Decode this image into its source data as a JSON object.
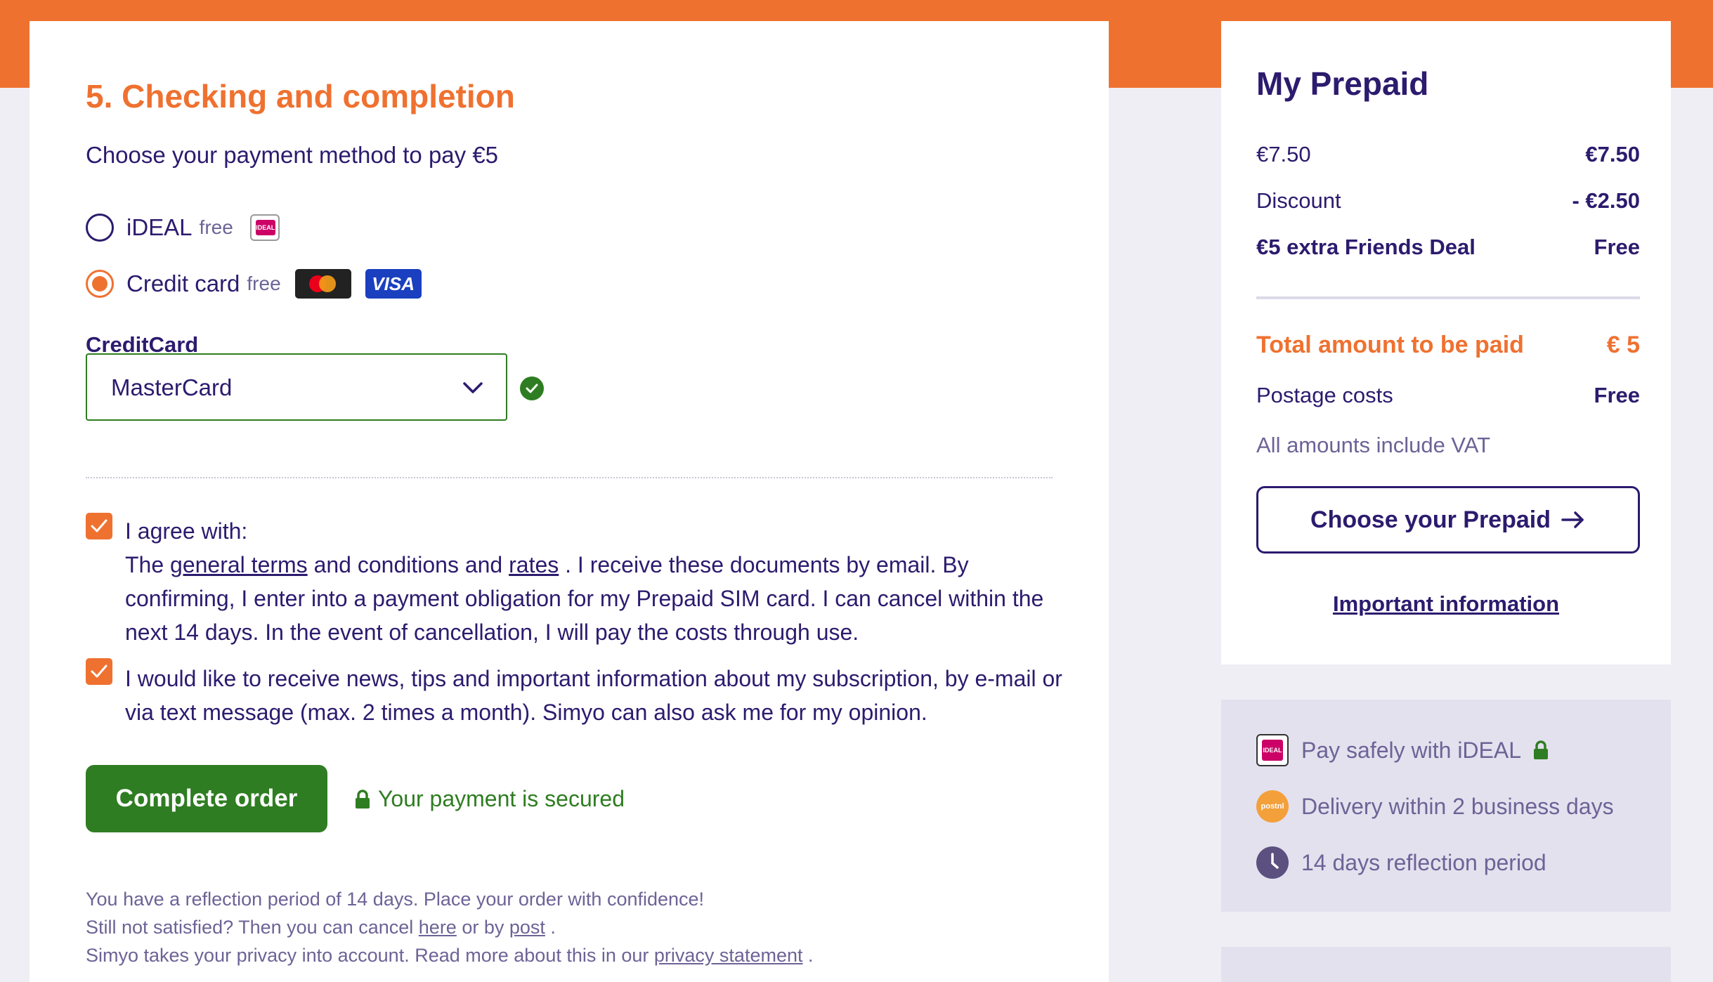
{
  "checkout": {
    "step_title": "5. Checking and completion",
    "pay_intro": "Choose your payment method to pay €5",
    "payment_methods": [
      {
        "label": "iDEAL",
        "sub": "free",
        "selected": false,
        "logo": "IDEAL"
      },
      {
        "label": "Credit card",
        "sub": "free",
        "selected": true,
        "logo_visa": "VISA"
      }
    ],
    "creditcard_label": "CreditCard",
    "creditcard_select": {
      "value": "MasterCard"
    },
    "agree": {
      "intro": "I agree with:",
      "text_1": "The ",
      "link_terms": "general terms",
      "text_2": " and conditions and ",
      "link_rates": "rates",
      "text_3": " . I receive these documents by email. By confirming, I enter into a payment obligation for my Prepaid SIM card. I can cancel within the next 14 days. In the event of cancellation, I will pay the costs through use.",
      "checked": true
    },
    "newsletter": {
      "text": "I would like to receive news, tips and important information about my subscription, by e-mail or via text message (max. 2 times a month). Simyo can also ask me for my opinion.",
      "checked": true
    },
    "complete_button": "Complete order",
    "secured_text": "Your payment is secured",
    "footnote": {
      "line1": "You have a reflection period of 14 days. Place your order with confidence!",
      "line2_a": "Still not satisfied? Then you can cancel ",
      "line2_link1": "here",
      "line2_b": " or by ",
      "line2_link2": "post",
      "line2_c": " .",
      "line3_a": "Simyo takes your privacy into account. Read more about this in our ",
      "line3_link": "privacy statement",
      "line3_b": " ."
    }
  },
  "summary": {
    "title": "My Prepaid",
    "rows": [
      {
        "label": "€7.50",
        "amount": "€7.50"
      },
      {
        "label": "Discount",
        "amount": "- €2.50"
      },
      {
        "label": "€5 extra Friends Deal",
        "amount": "Free"
      }
    ],
    "total_label": "Total amount to be paid",
    "total_amount": "€ 5",
    "postage_label": "Postage costs",
    "postage_amount": "Free",
    "vat_note": "All amounts include VAT",
    "prepaid_button": "Choose your Prepaid",
    "important_link": "Important information"
  },
  "usps": [
    {
      "icon": "ideal-icon",
      "text": "Pay safely with iDEAL",
      "badge": "IDEAL"
    },
    {
      "icon": "postnl-icon",
      "text": "Delivery within 2 business days",
      "badge": "postnl"
    },
    {
      "icon": "clock-icon",
      "text": "14 days reflection period"
    }
  ],
  "colors": {
    "brand_orange": "#ef7130",
    "brand_purple": "#2c1b6e",
    "success_green": "#2f7d22",
    "muted_text": "#6d6396"
  }
}
